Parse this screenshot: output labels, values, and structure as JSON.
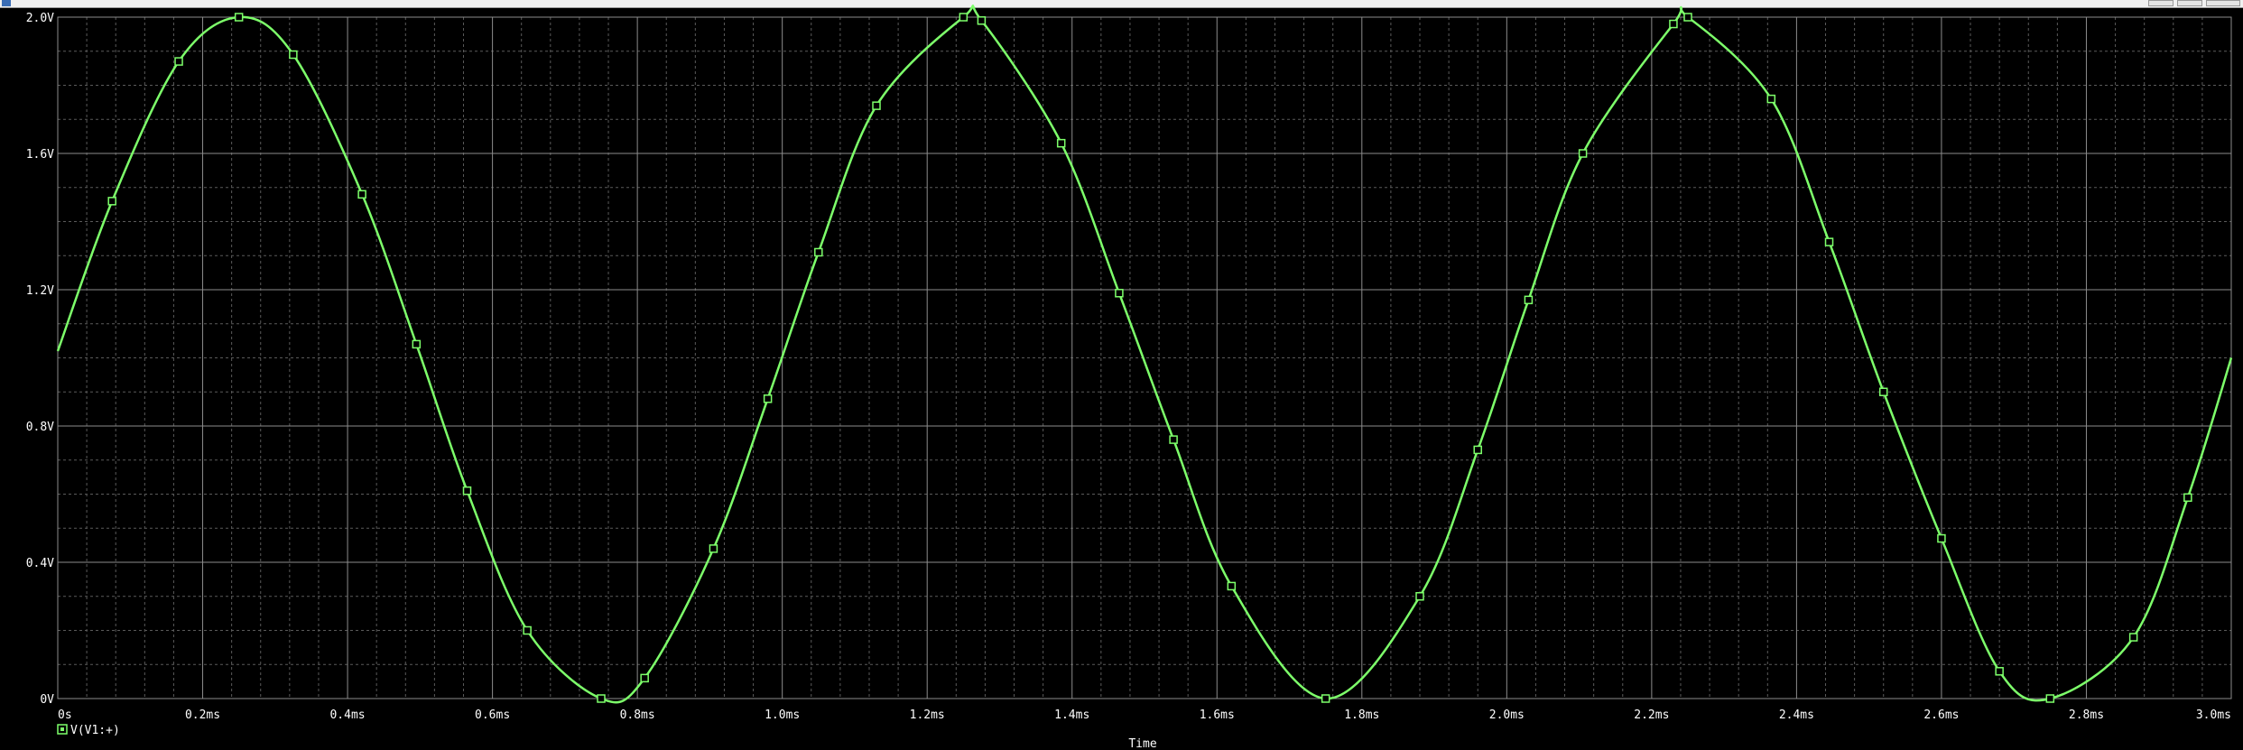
{
  "window": {
    "title": ""
  },
  "colors": {
    "background": "#000000",
    "grid_major": "#8c8c8c",
    "grid_minor": "#5a5a5a",
    "trace": "#7dff6a",
    "text": "#ffffff"
  },
  "chart_data": {
    "type": "line",
    "title": "",
    "xlabel": "Time",
    "ylabel": "",
    "xlim": [
      0,
      3.0
    ],
    "ylim": [
      0,
      2.0
    ],
    "x_unit": "ms",
    "y_unit": "V",
    "xticks": [
      0,
      0.2,
      0.4,
      0.6,
      0.8,
      1.0,
      1.2,
      1.4,
      1.6,
      1.8,
      2.0,
      2.2,
      2.4,
      2.6,
      2.8,
      3.0
    ],
    "xtick_labels": [
      "0s",
      "0.2ms",
      "0.4ms",
      "0.6ms",
      "0.8ms",
      "1.0ms",
      "1.2ms",
      "1.4ms",
      "1.6ms",
      "1.8ms",
      "2.0ms",
      "2.2ms",
      "2.4ms",
      "2.6ms",
      "2.8ms",
      "3.0ms"
    ],
    "yticks": [
      0,
      0.4,
      0.8,
      1.2,
      1.6,
      2.0
    ],
    "ytick_labels": [
      "0V",
      "0.4V",
      "0.8V",
      "1.2V",
      "1.6V",
      "2.0V"
    ],
    "grid": true,
    "legend": {
      "position": "bottom-left",
      "entries": [
        "V(V1:+)"
      ]
    },
    "series": [
      {
        "name": "V(V1:+)",
        "color": "#7dff6a",
        "marker": "square",
        "x": [
          0,
          0.075,
          0.167,
          0.25,
          0.325,
          0.42,
          0.495,
          0.565,
          0.648,
          0.75,
          0.81,
          0.905,
          0.98,
          1.05,
          1.13,
          1.25,
          1.275,
          1.385,
          1.465,
          1.54,
          1.62,
          1.75,
          1.88,
          1.96,
          2.03,
          2.105,
          2.23,
          2.25,
          2.365,
          2.445,
          2.52,
          2.6,
          2.68,
          2.75,
          2.865,
          2.94,
          3.0
        ],
        "y": [
          1.02,
          1.46,
          1.87,
          2.0,
          1.89,
          1.48,
          1.04,
          0.61,
          0.2,
          0.0,
          0.06,
          0.44,
          0.88,
          1.31,
          1.74,
          2.0,
          1.99,
          1.63,
          1.19,
          0.76,
          0.33,
          0.0,
          0.3,
          0.73,
          1.17,
          1.6,
          1.98,
          2.0,
          1.76,
          1.34,
          0.9,
          0.47,
          0.08,
          0.0,
          0.18,
          0.59,
          1.0
        ]
      }
    ]
  }
}
